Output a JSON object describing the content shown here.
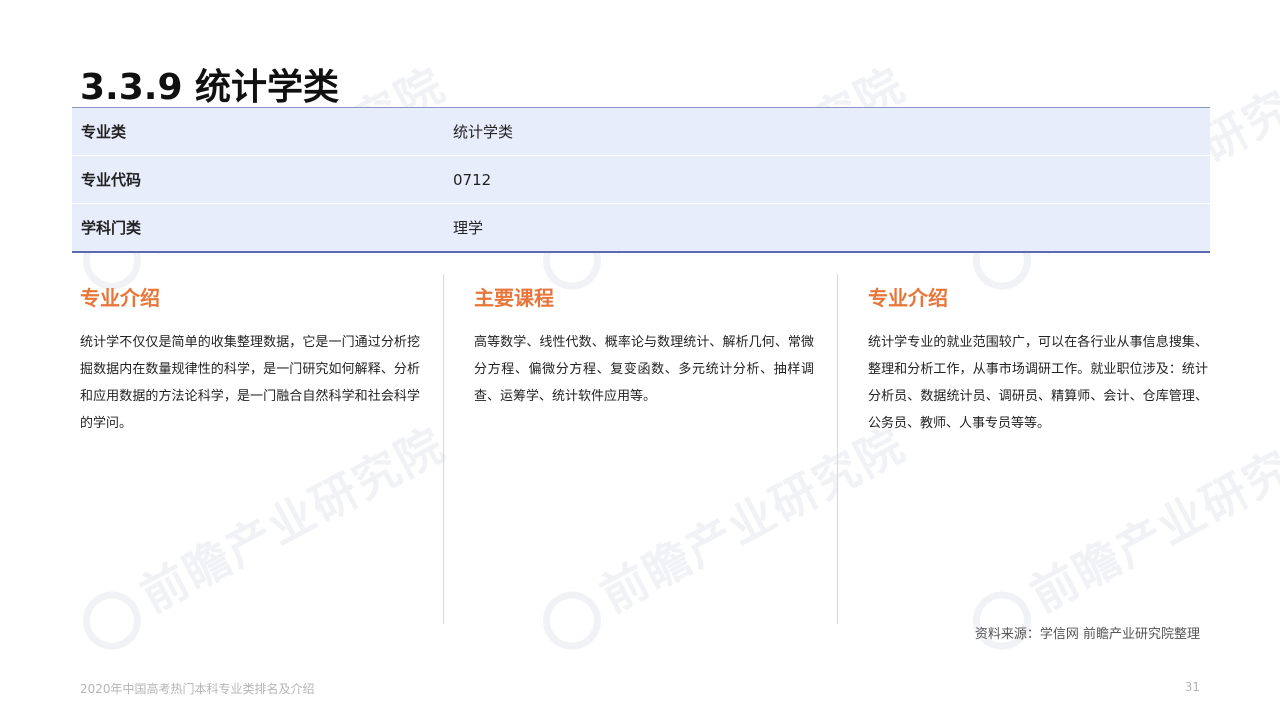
{
  "title": "3.3.9 统计学类",
  "info_table": [
    {
      "key": "专业类",
      "value": "统计学类"
    },
    {
      "key": "专业代码",
      "value": "0712"
    },
    {
      "key": "学科门类",
      "value": "理学"
    }
  ],
  "columns": [
    {
      "heading": "专业介绍",
      "body": "统计学不仅仅是简单的收集整理数据，它是一门通过分析挖掘数据内在数量规律性的科学，是一门研究如何解释、分析和应用数据的方法论科学，是一门融合自然科学和社会科学的学问。"
    },
    {
      "heading": "主要课程",
      "body": "高等数学、线性代数、概率论与数理统计、解析几何、常微分方程、偏微分方程、复变函数、多元统计分析、抽样调查、运筹学、统计软件应用等。"
    },
    {
      "heading": "专业介绍",
      "body": "统计学专业的就业范围较广，可以在各行业从事信息搜集、整理和分析工作，从事市场调研工作。就业职位涉及：统计分析员、数据统计员、调研员、精算师、会计、仓库管理、公务员、教师、人事专员等等。"
    }
  ],
  "source": "资料来源：学信网 前瞻产业研究院整理",
  "footer": {
    "left": "2020年中国高考热门本科专业类排名及介绍",
    "page_number": "31"
  },
  "watermark": {
    "text": "前瞻产业研究院"
  },
  "colors": {
    "accent": "#e8763a",
    "table_bg": "#e8edfb",
    "table_border": "#5a6bb0"
  }
}
